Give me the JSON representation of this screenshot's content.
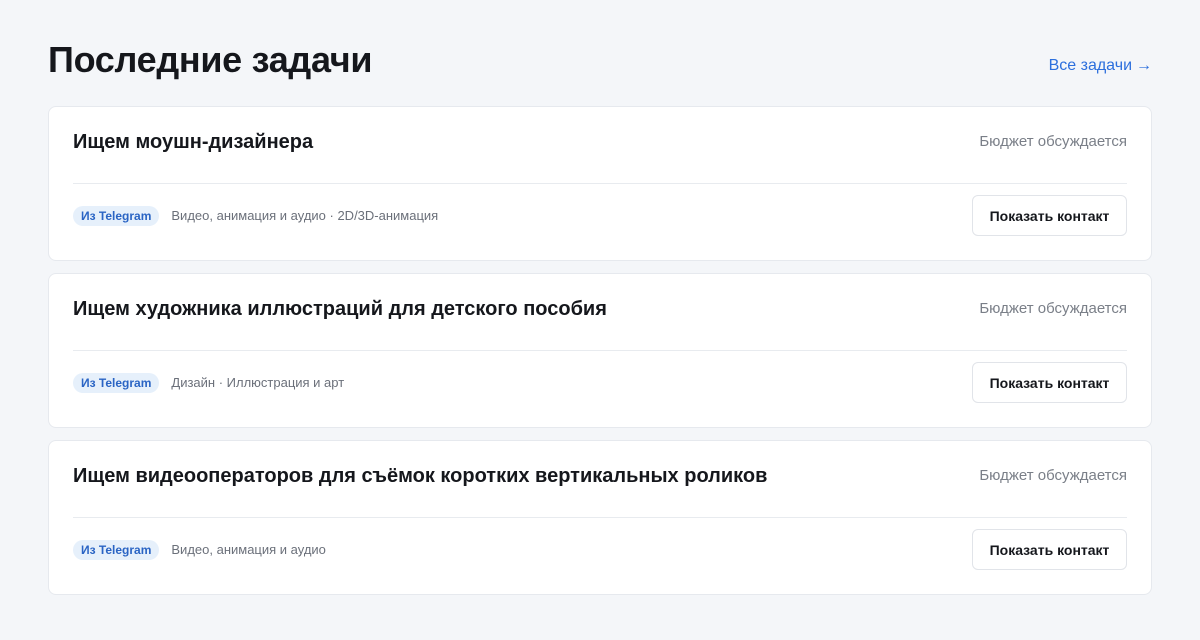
{
  "header": {
    "title": "Последние задачи",
    "all_tasks_label": "Все задачи",
    "all_tasks_arrow": "→"
  },
  "tasks": [
    {
      "title": "Ищем моушн-дизайнера",
      "budget": "Бюджет обсуждается",
      "source_badge": "Из Telegram",
      "category": "Видео, анимация и аудио · 2D/3D-анимация",
      "contact_button": "Показать контакт"
    },
    {
      "title": "Ищем художника иллюстраций для детского пособия",
      "budget": "Бюджет обсуждается",
      "source_badge": "Из Telegram",
      "category": "Дизайн · Иллюстрация и арт",
      "contact_button": "Показать контакт"
    },
    {
      "title": "Ищем видеооператоров для съёмок коротких вертикальных роликов",
      "budget": "Бюджет обсуждается",
      "source_badge": "Из Telegram",
      "category": "Видео, анимация и аудио",
      "contact_button": "Показать контакт"
    }
  ],
  "colors": {
    "background": "#f4f6f9",
    "card": "#ffffff",
    "link": "#2c6fdd",
    "badge_bg": "#e6f0fb",
    "badge_text": "#2a64c4",
    "muted_text": "#7a7f88"
  }
}
